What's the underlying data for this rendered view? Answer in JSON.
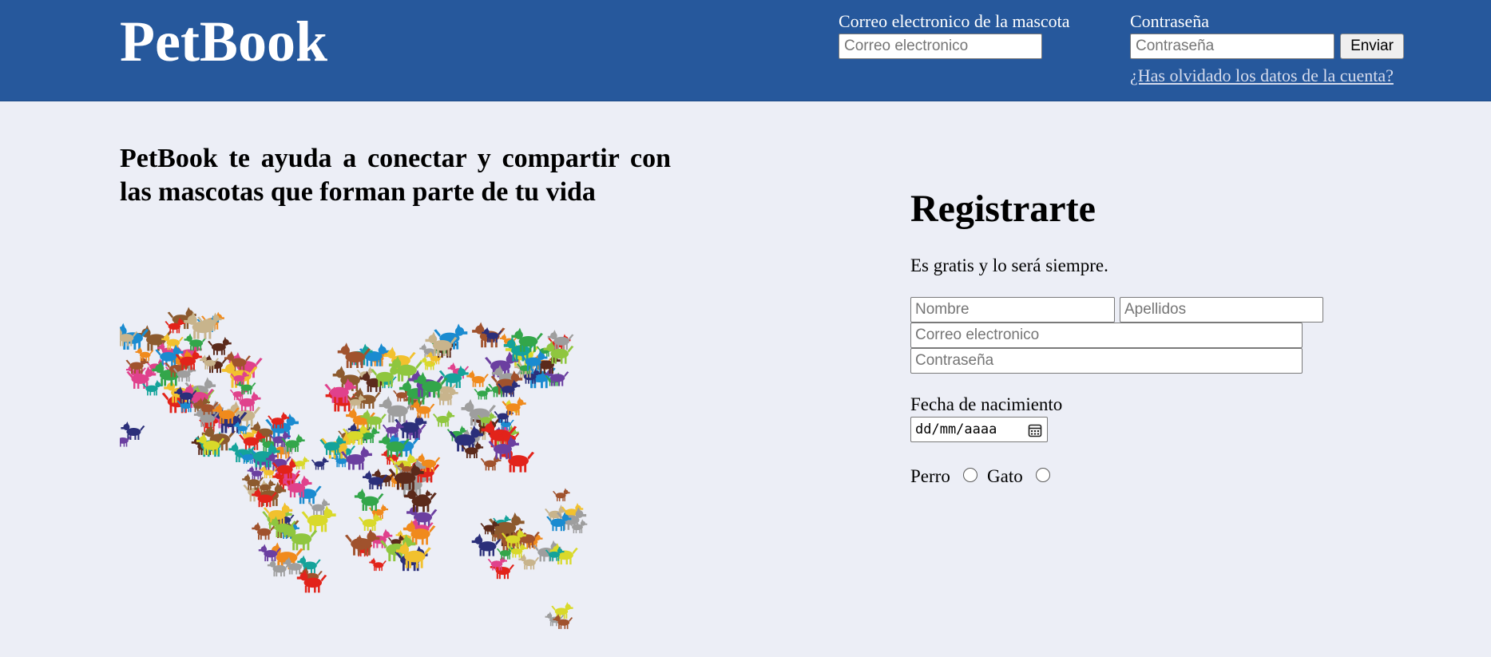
{
  "header": {
    "logo": "PetBook",
    "email_label": "Correo electronico de la mascota",
    "email_placeholder": "Correo electronico",
    "password_label": "Contraseña",
    "password_placeholder": "Contraseña",
    "send_label": "Enviar",
    "forgot_link": "¿Has olvidado los datos de la cuenta?"
  },
  "main": {
    "tagline": "PetBook te ayuda a conectar y compartir con las mascotas que forman parte de tu vida",
    "map_icon": "world-map-of-dogs-illustration"
  },
  "register": {
    "title": "Registrarte",
    "subtitle": "Es gratis y lo será siempre.",
    "first_name_placeholder": "Nombre",
    "last_name_placeholder": "Apellidos",
    "email_placeholder": "Correo electronico",
    "password_placeholder": "Contraseña",
    "birth_label": "Fecha de nacimiento",
    "birth_placeholder": "dd/mm/aaaa",
    "dog_label": "Perro",
    "cat_label": "Gato"
  },
  "colors": {
    "header_bg": "#26589c",
    "page_bg": "#eceef6",
    "link": "#d6dced"
  }
}
